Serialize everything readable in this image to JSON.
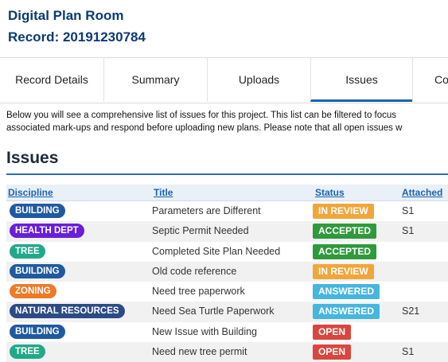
{
  "header": {
    "app_title": "Digital Plan Room",
    "record_title": "Record: 20191230784"
  },
  "tabs": [
    {
      "label": "Record Details"
    },
    {
      "label": "Summary"
    },
    {
      "label": "Uploads"
    },
    {
      "label": "Issues",
      "active": true
    },
    {
      "label": "Co"
    }
  ],
  "intro": {
    "line1": "Below you will see a comprehensive list of issues for this project. This list can be filtered to focus",
    "line2": "associated mark-ups and respond before uploading new plans. Please note that all open issues w"
  },
  "section_title": "Issues",
  "table": {
    "columns": [
      "Discipline",
      "Title",
      "Status",
      "Attached"
    ],
    "rows": [
      {
        "discipline": "BUILDING",
        "title": "Parameters are Different",
        "status": "IN REVIEW",
        "attached": "S1"
      },
      {
        "discipline": "HEALTH DEPT",
        "title": "Septic Permit Needed",
        "status": "ACCEPTED",
        "attached": "S1"
      },
      {
        "discipline": "TREE",
        "title": "Completed Site Plan Needed",
        "status": "ACCEPTED",
        "attached": ""
      },
      {
        "discipline": "BUILDING",
        "title": "Old code reference",
        "status": "IN REVIEW",
        "attached": ""
      },
      {
        "discipline": "ZONING",
        "title": "Need tree paperwork",
        "status": "ANSWERED",
        "attached": ""
      },
      {
        "discipline": "NATURAL RESOURCES",
        "title": "Need Sea Turtle Paperwork",
        "status": "ANSWERED",
        "attached": "S21"
      },
      {
        "discipline": "BUILDING",
        "title": "New Issue with Building",
        "status": "OPEN",
        "attached": ""
      },
      {
        "discipline": "TREE",
        "title": "Need new tree permit",
        "status": "OPEN",
        "attached": "S1"
      }
    ]
  },
  "colors": {
    "brand_title": "#0b3a75",
    "tab_active_underline": "#1a63b0",
    "disciplines": {
      "BUILDING": "#1f5aa0",
      "HEALTH DEPT": "#6a1fd6",
      "TREE": "#20a98a",
      "ZONING": "#ee7a26",
      "NATURAL RESOURCES": "#2b4b86"
    },
    "statuses": {
      "IN REVIEW": "#f0a63a",
      "ACCEPTED": "#2e9a3c",
      "ANSWERED": "#45b6de",
      "OPEN": "#d9463e"
    }
  }
}
